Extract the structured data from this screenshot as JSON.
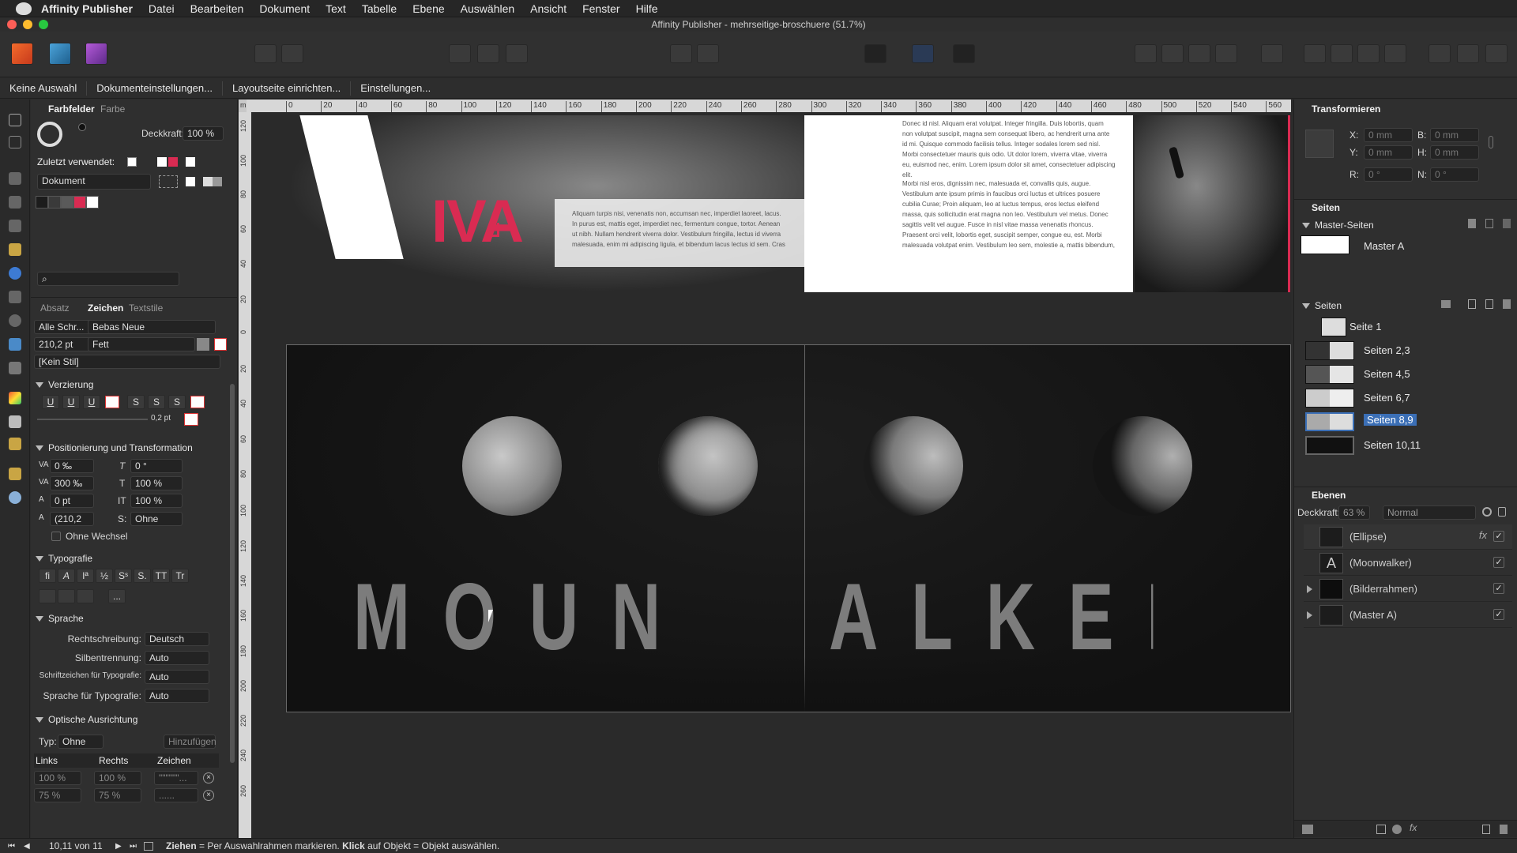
{
  "menubar": {
    "app": "Affinity Publisher",
    "items": [
      "Datei",
      "Bearbeiten",
      "Dokument",
      "Text",
      "Tabelle",
      "Ebene",
      "Auswählen",
      "Ansicht",
      "Fenster",
      "Hilfe"
    ]
  },
  "window": {
    "title": "Affinity Publisher - mehrseitige-broschuere (51.7%)"
  },
  "context": {
    "selection": "Keine Auswahl",
    "doc_settings": "Dokumenteinstellungen...",
    "layout_setup": "Layoutseite einrichten...",
    "settings": "Einstellungen..."
  },
  "swatches": {
    "tab_active": "Farbfelder",
    "tab_other": "Farbe",
    "opacity_label": "Deckkraft:",
    "opacity_value": "100 %",
    "recent_label": "Zuletzt verwendet:",
    "palette": "Dokument",
    "colors": [
      "#1c1c1c",
      "#3a3a3a",
      "#5a5a5a",
      "#d92b52",
      "#ffffff"
    ]
  },
  "char_panel": {
    "tab1": "Absatz",
    "tab2": "Zeichen",
    "tab3": "Textstile",
    "font_collection": "Alle Schr...",
    "font_family": "Bebas Neue",
    "size": "210,2 pt",
    "weight": "Fett",
    "style": "[Kein Stil]",
    "deco_title": "Verzierung",
    "deco_size": "0,2 pt",
    "pos_title": "Positionierung und Transformation",
    "tracking": "0 ‰",
    "kerning": "300 ‰",
    "baseline": "0 pt",
    "leading": "(210,2",
    "skew": "0 °",
    "vscale": "100 %",
    "hscale": "100 %",
    "case": "Ohne",
    "no_break": "Ohne Wechsel",
    "typo_title": "Typografie",
    "lang_title": "Sprache",
    "spell_label": "Rechtschreibung:",
    "spell_value": "Deutsch",
    "hyph_label": "Silbentrennung:",
    "hyph_value": "Auto",
    "script_label": "Schriftzeichen für Typografie:",
    "script_value": "Auto",
    "langtypo_label": "Sprache für Typografie:",
    "langtypo_value": "Auto",
    "optical_title": "Optische Ausrichtung",
    "type_label": "Typ:",
    "type_value": "Ohne",
    "add_label": "Hinzufügen",
    "col_left": "Links",
    "col_right": "Rechts",
    "col_char": "Zeichen",
    "r1_left": "100 %",
    "r1_right": "100 %",
    "r1_char": "\"\"\"\"\"\"...",
    "r2_left": "75 %",
    "r2_right": "75 %",
    "r2_char": "......"
  },
  "ruler_ticks": [
    "0",
    "20",
    "40",
    "60",
    "80",
    "100",
    "120",
    "140",
    "160",
    "180",
    "200",
    "220",
    "240",
    "260",
    "280",
    "300",
    "320",
    "340",
    "360",
    "380",
    "400",
    "420",
    "440",
    "460",
    "480",
    "500",
    "520",
    "540",
    "560"
  ],
  "ruler_v_ticks": [
    "120",
    "100",
    "80",
    "60",
    "40",
    "20",
    "0",
    "20",
    "40",
    "60",
    "80",
    "100",
    "120",
    "140",
    "160",
    "180",
    "200",
    "220",
    "240",
    "260"
  ],
  "ruler_unit": "mm",
  "canvas": {
    "viva_text": "IVA",
    "lorem1": "Aliquam turpis nisi, venenatis non, accumsan nec, imperdiet laoreet, lacus. In purus est, mattis eget, imperdiet nec, fermentum congue, tortor. Aenean ut nibh. Nullam hendrerit viverra dolor. Vestibulum fringilla, lectus id viverra malesuada, enim mi adipiscing ligula, et bibendum lacus lectus id sem. Cras",
    "lorem2": "Donec id nisl. Aliquam erat volutpat. Integer fringilla. Duis lobortis, quam non volutpat suscipit, magna sem consequat libero, ac hendrerit urna ante id mi. Quisque commodo facilisis tellus. Integer sodales lorem sed nisl. Morbi consectetuer mauris quis odio. Ut dolor lorem, viverra vitae, viverra eu, euismod nec, enim. Lorem ipsum dolor sit amet, consectetuer adipiscing elit.",
    "lorem3": "Morbi nisl eros, dignissim nec, malesuada et, convallis quis, augue. Vestibulum ante ipsum primis in faucibus orci luctus et ultrices posuere cubilia Curae; Proin aliquam, leo at luctus tempus, eros lectus eleifend massa, quis sollicitudin erat magna non leo. Vestibulum vel metus. Donec sagittis velit vel augue. Fusce in nisl vitae massa venenatis rhoncus. Praesent orci velit, lobortis eget, suscipit semper, congue eu, est. Morbi malesuada volutpat enim. Vestibulum leo sem, molestie a, mattis bibendum,",
    "moonwalker_left": "MOUNW",
    "moonwalker_right": "ALKER"
  },
  "transform": {
    "title": "Transformieren",
    "x_label": "X:",
    "x": "0 mm",
    "y_label": "Y:",
    "y": "0 mm",
    "w_label": "B:",
    "w": "0 mm",
    "h_label": "H:",
    "h": "0 mm",
    "r_label": "R:",
    "r": "0 °",
    "s_label": "N:",
    "s": "0 °"
  },
  "pages": {
    "title": "Seiten",
    "master_title": "Master-Seiten",
    "master": "Master A",
    "pages_title": "Seiten",
    "items": [
      "Seite 1",
      "Seiten 2,3",
      "Seiten 4,5",
      "Seiten 6,7",
      "Seiten 8,9",
      "Seiten 10,11"
    ]
  },
  "layers": {
    "title": "Ebenen",
    "opacity_label": "Deckkraft:",
    "opacity": "63 %",
    "blend": "Normal",
    "items": [
      "(Ellipse)",
      "(Moonwalker)",
      "(Bilderrahmen)",
      "(Master A)"
    ]
  },
  "status": {
    "page": "10,11 von 11",
    "hint_bold1": "Ziehen",
    "hint1": " = Per Auswahlrahmen markieren. ",
    "hint_bold2": "Klick",
    "hint2": " auf Objekt = Objekt auswählen."
  },
  "colors": {
    "accent": "#d92b52",
    "selection": "#3b6fb6"
  }
}
